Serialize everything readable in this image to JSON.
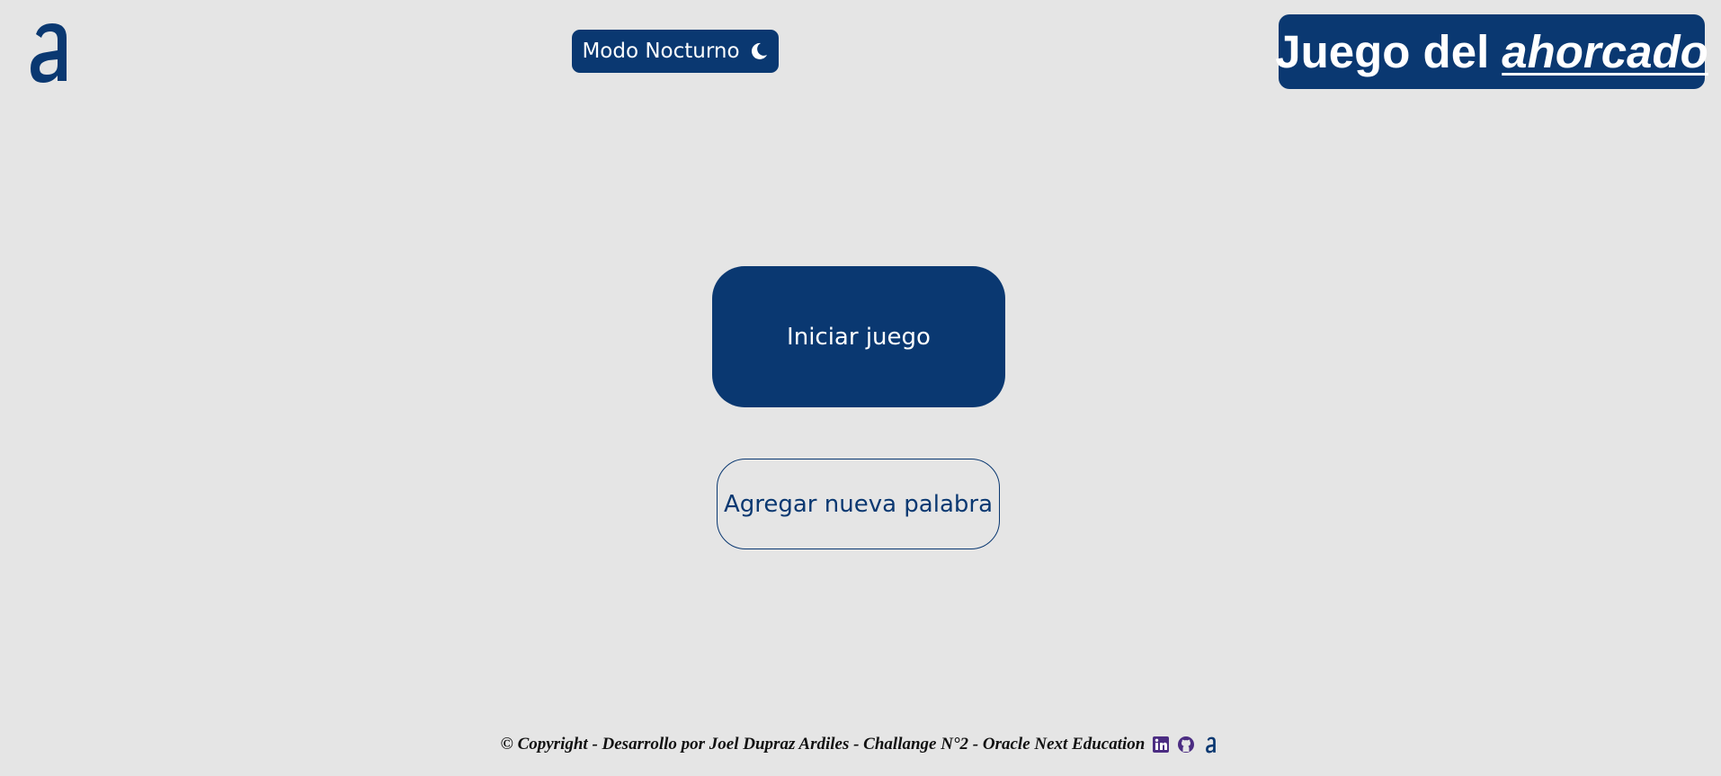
{
  "header": {
    "night_mode_label": "Modo Nocturno",
    "night_mode_icon": "moon-icon",
    "title_prefix": "Juego del",
    "title_emphasis": "ahorcado",
    "logo_icon": "alura-logo"
  },
  "main": {
    "start_label": "Iniciar juego",
    "add_word_label": "Agregar nueva palabra"
  },
  "footer": {
    "text": "© Copyright - Desarrollo por Joel Dupraz Ardiles - Challange N°2 - Oracle Next Education",
    "icons": [
      "linkedin-icon",
      "github-icon",
      "alura-icon"
    ]
  },
  "colors": {
    "background": "#e5e5e5",
    "primary": "#0a3871",
    "icon_purple": "#4b2c82",
    "text_dark": "#111111"
  }
}
